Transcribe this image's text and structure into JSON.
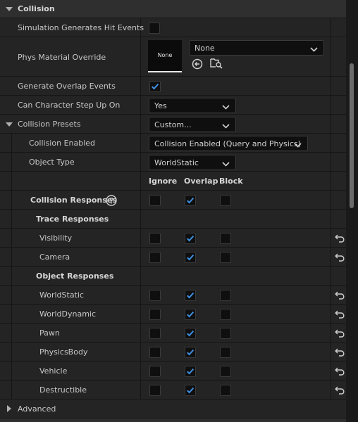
{
  "section": {
    "title": "Collision",
    "footer": "Advanced"
  },
  "props": {
    "sim_hit": {
      "label": "Simulation Generates Hit Events",
      "checked": false
    },
    "phys_mat": {
      "label": "Phys Material Override",
      "thumb": "None",
      "value": "None"
    },
    "overlap": {
      "label": "Generate Overlap Events",
      "checked": true
    },
    "step_up": {
      "label": "Can Character Step Up On",
      "value": "Yes"
    },
    "presets": {
      "label": "Collision Presets",
      "value": "Custom..."
    },
    "enabled": {
      "label": "Collision Enabled",
      "value": "Collision Enabled (Query and Physics)"
    },
    "object_type": {
      "label": "Object Type",
      "value": "WorldStatic"
    }
  },
  "columns": {
    "ignore": "Ignore",
    "overlap": "Overlap",
    "block": "Block"
  },
  "responses": {
    "label": "Collision Responses",
    "all": {
      "ignore": false,
      "overlap": true,
      "block": false
    },
    "trace_header": "Trace Responses",
    "trace": [
      {
        "label": "Visibility",
        "ignore": false,
        "overlap": true,
        "block": false
      },
      {
        "label": "Camera",
        "ignore": false,
        "overlap": true,
        "block": false
      }
    ],
    "object_header": "Object Responses",
    "object": [
      {
        "label": "WorldStatic",
        "ignore": false,
        "overlap": true,
        "block": false
      },
      {
        "label": "WorldDynamic",
        "ignore": false,
        "overlap": true,
        "block": false
      },
      {
        "label": "Pawn",
        "ignore": false,
        "overlap": true,
        "block": false
      },
      {
        "label": "PhysicsBody",
        "ignore": false,
        "overlap": true,
        "block": false
      },
      {
        "label": "Vehicle",
        "ignore": false,
        "overlap": true,
        "block": false
      },
      {
        "label": "Destructible",
        "ignore": false,
        "overlap": true,
        "block": false
      }
    ]
  },
  "icons": {
    "collapse": "triangle-down-icon",
    "expand": "triangle-right-icon",
    "help": "question-circle-icon",
    "reset": "reset-arrow-icon",
    "use_asset": "arrow-left-circle-icon",
    "browse": "folder-search-icon",
    "check": "checkmark-icon",
    "chevron": "chevron-down-icon"
  },
  "colors": {
    "checkmark": "#3d8fe0",
    "panel": "#242424",
    "input": "#0f0f0f"
  }
}
